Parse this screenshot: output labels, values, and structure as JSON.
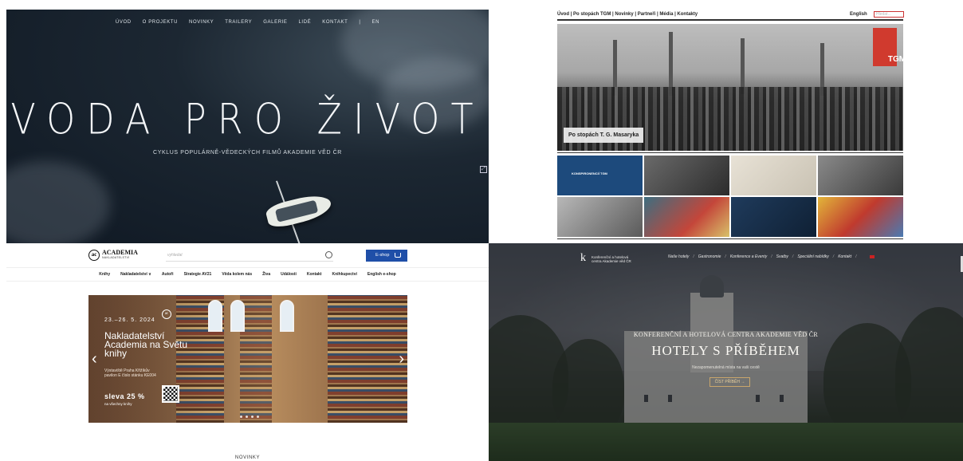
{
  "q1": {
    "nav": [
      "ÚVOD",
      "O PROJEKTU",
      "NOVINKY",
      "TRAILERY",
      "GALERIE",
      "LIDÉ",
      "KONTAKT",
      "|",
      "EN"
    ],
    "title": "VODA PRO ŽIVOT",
    "subtitle": "CYKLUS POPULÁRNĚ-VĚDECKÝCH FILMŮ AKADEMIE VĚD ČR"
  },
  "q2": {
    "nav": "Úvod | Po stopách TGM | Novinky | Partneři | Média | Kontakty",
    "lang": "English",
    "search_placeholder": "Hledat...",
    "caption": "Po stopách T. G. Masaryka",
    "logo": "TGM",
    "tile_label": "KONSPIRONENCIÍ TGM"
  },
  "q3": {
    "logo_mark": "ac",
    "logo_name": "ACADEMIA",
    "logo_sub": "NAKLADATELSTVÍ",
    "search_placeholder": "vyhledat",
    "eshop": "E-shop",
    "menu": [
      "Knihy",
      "Nakladatelství ∨",
      "Autoři",
      "Strategie AV21",
      "Věda kolem nás",
      "Živa",
      "Události",
      "Kontakt",
      "Knihkupectví",
      "English e-shop"
    ],
    "banner": {
      "date": "23.–26. 5. 2024",
      "title": "Nakladatelství Academia na Světu knihy",
      "info": "Výstaviště Praha Křižíkův pavilon E číslo stánku KE004",
      "sale": "sleva 25 %",
      "sale_sub": "na všechny knihy",
      "logo": "ac",
      "prev": "‹",
      "next": "›"
    },
    "section": "NOVINKY"
  },
  "q4": {
    "logo_mark": "k",
    "logo_text_1": "Konferenční a hotelová",
    "logo_text_2": "centra Akademie věd ČR",
    "nav": [
      "Naše hotely",
      "Gastronomie",
      "Konference a Eventy",
      "Svatby",
      "Speciální nabídky",
      "Kontakt"
    ],
    "kicker": "KONFERENČNÍ A HOTELOVÁ CENTRA AKADEMIE VĚD ČR",
    "title": "HOTELY S PŘÍBĚHEM",
    "sub": "Nezapomenutelná místa na vaši cestě",
    "cta": "ČÍST PŘÍBĚH →"
  }
}
